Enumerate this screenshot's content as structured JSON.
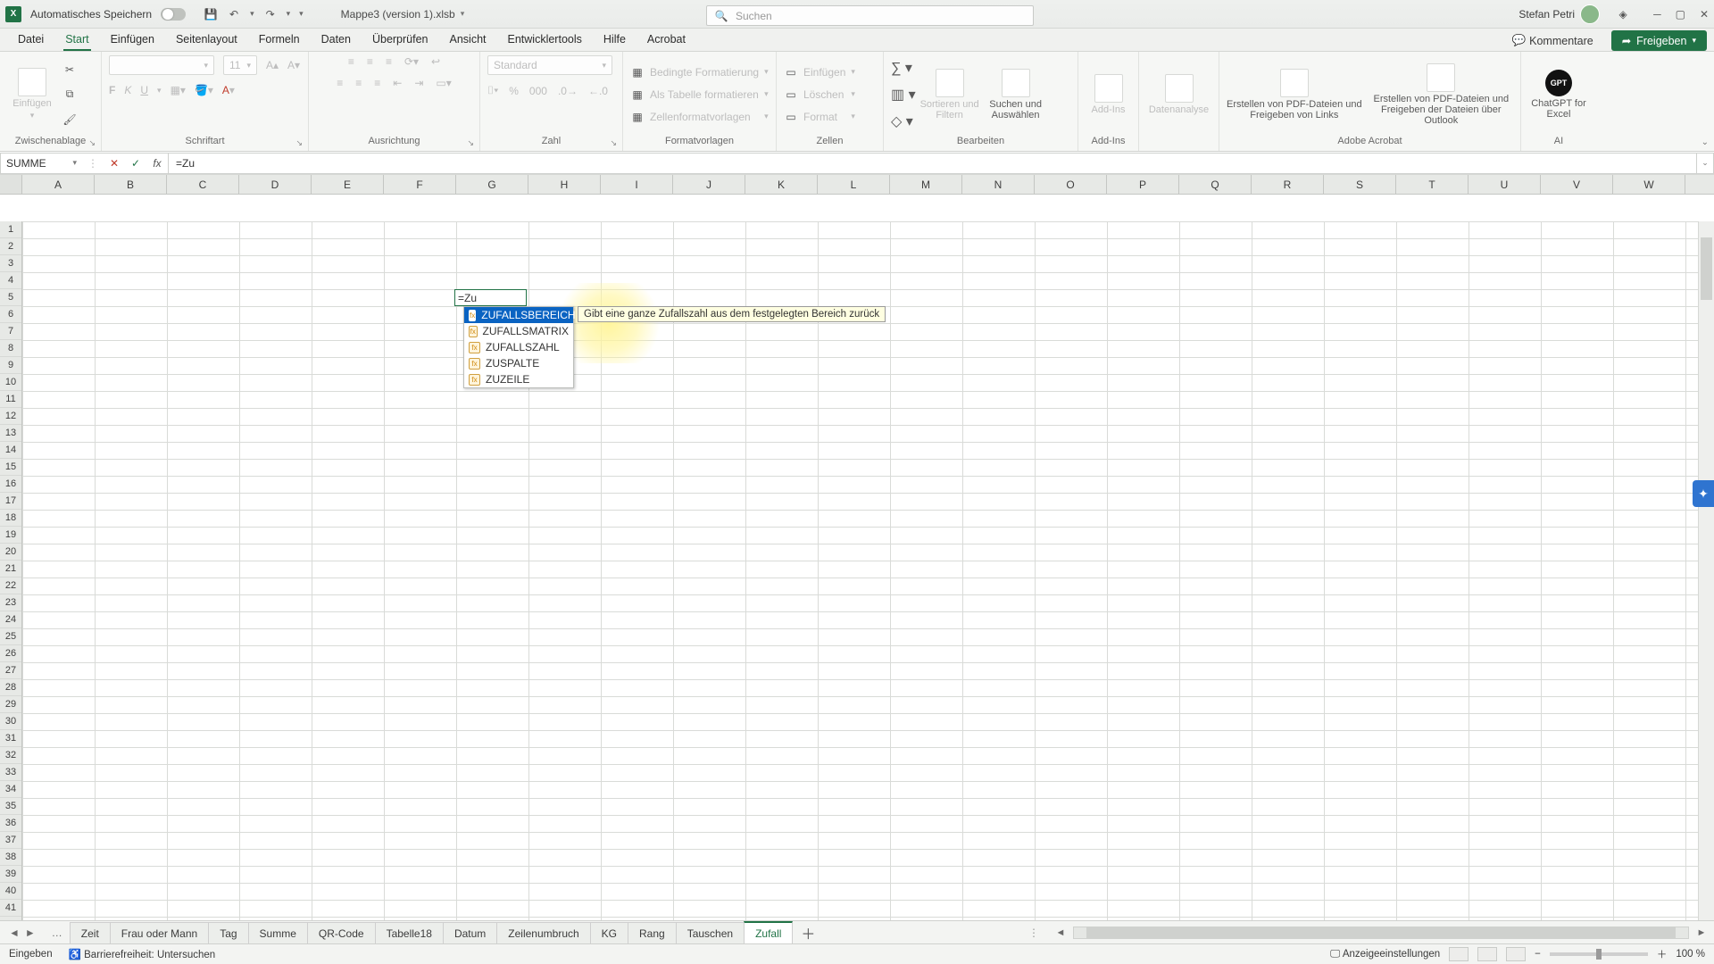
{
  "titlebar": {
    "autosave_label": "Automatisches Speichern",
    "document_name": "Mappe3 (version 1).xlsb",
    "search_placeholder": "Suchen",
    "user_name": "Stefan Petri"
  },
  "ribbon_tabs": {
    "items": [
      "Datei",
      "Start",
      "Einfügen",
      "Seitenlayout",
      "Formeln",
      "Daten",
      "Überprüfen",
      "Ansicht",
      "Entwicklertools",
      "Hilfe",
      "Acrobat"
    ],
    "active": "Start",
    "comments": "Kommentare",
    "share": "Freigeben"
  },
  "ribbon": {
    "paste_label": "Einfügen",
    "clipboard_caption": "Zwischenablage",
    "font_caption": "Schriftart",
    "font_size": "11",
    "alignment_caption": "Ausrichtung",
    "number_caption": "Zahl",
    "number_format": "Standard",
    "styles_caption": "Formatvorlagen",
    "style_items": [
      "Bedingte Formatierung",
      "Als Tabelle formatieren",
      "Zellenformatvorlagen"
    ],
    "cells_caption": "Zellen",
    "cells_items": [
      "Einfügen",
      "Löschen",
      "Format"
    ],
    "editing_caption": "Bearbeiten",
    "sort_label": "Sortieren und Filtern",
    "find_label": "Suchen und Auswählen",
    "addins_caption": "Add-Ins",
    "addins_label": "Add-Ins",
    "analysis_label": "Datenanalyse",
    "acrobat_caption": "Adobe Acrobat",
    "acrobat1": "Erstellen von PDF-Dateien und Freigeben von Links",
    "acrobat2": "Erstellen von PDF-Dateien und Freigeben der Dateien über Outlook",
    "ai_caption": "AI",
    "gpt_label": "ChatGPT for Excel"
  },
  "formula_bar": {
    "name_box": "SUMME",
    "value": "=Zu"
  },
  "columns": [
    "A",
    "B",
    "C",
    "D",
    "E",
    "F",
    "G",
    "H",
    "I",
    "J",
    "K",
    "L",
    "M",
    "N",
    "O",
    "P",
    "Q",
    "R",
    "S",
    "T",
    "U",
    "V",
    "W"
  ],
  "row_count": 41,
  "cell_edit": {
    "text": "=Zu"
  },
  "fn_suggest": {
    "items": [
      "ZUFALLSBEREICH",
      "ZUFALLSMATRIX",
      "ZUFALLSZAHL",
      "ZUSPALTE",
      "ZUZEILE"
    ],
    "selected_index": 0,
    "tooltip": "Gibt eine ganze Zufallszahl aus dem festgelegten Bereich zurück"
  },
  "sheet_tabs": {
    "items": [
      "Zeit",
      "Frau oder Mann",
      "Tag",
      "Summe",
      "QR-Code",
      "Tabelle18",
      "Datum",
      "Zeilenumbruch",
      "KG",
      "Rang",
      "Tauschen",
      "Zufall"
    ],
    "active": "Zufall"
  },
  "status": {
    "mode": "Eingeben",
    "accessibility": "Barrierefreiheit: Untersuchen",
    "display_settings": "Anzeigeeinstellungen",
    "zoom": "100 %"
  }
}
